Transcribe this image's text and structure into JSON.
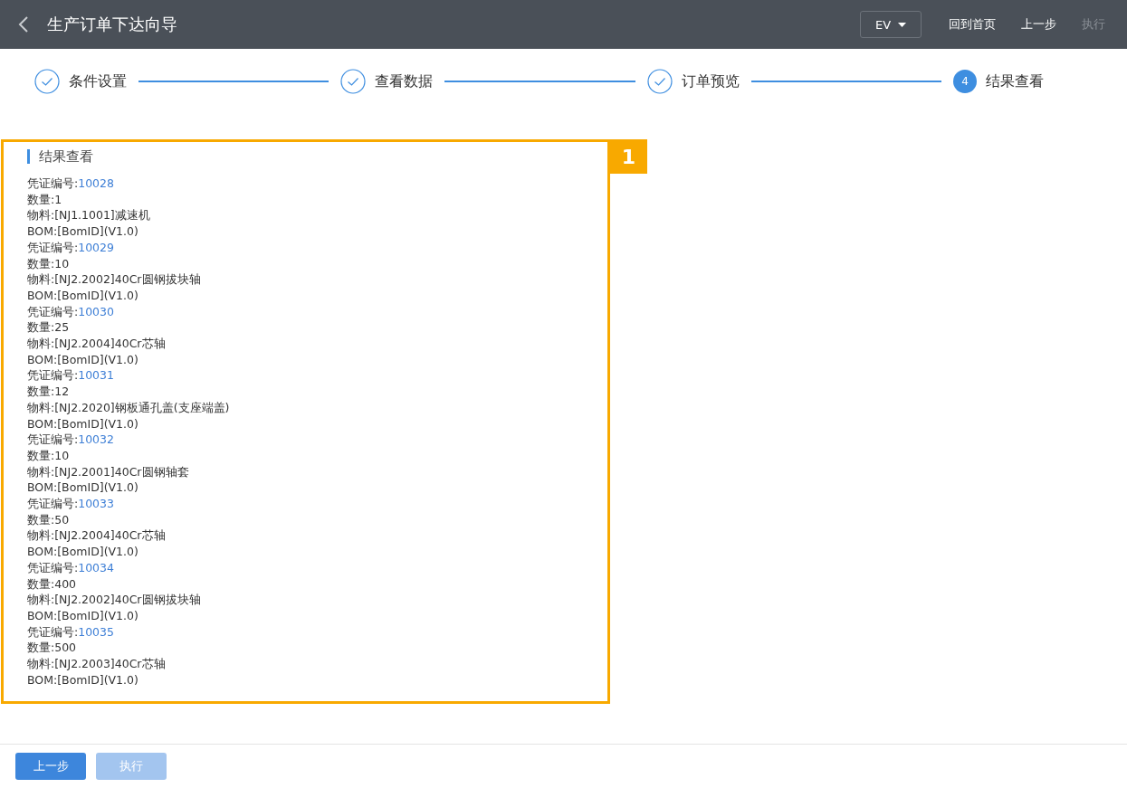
{
  "header": {
    "title": "生产订单下达向导",
    "dropdown": "EV",
    "actions": [
      {
        "label": "回到首页",
        "disabled": false
      },
      {
        "label": "上一步",
        "disabled": false
      },
      {
        "label": "执行",
        "disabled": true
      }
    ]
  },
  "steps": [
    {
      "label": "条件设置",
      "done": true
    },
    {
      "label": "查看数据",
      "done": true
    },
    {
      "label": "订单预览",
      "done": true
    },
    {
      "label": "结果查看",
      "done": false,
      "number": "4"
    }
  ],
  "panel": {
    "title": "结果查看",
    "callout": "1",
    "records": [
      {
        "voucher_label": "凭证编号:",
        "voucher": "10028",
        "quantity": "数量:1",
        "material": "物料:[NJ1.1001]减速机",
        "bom": "BOM:[BomID](V1.0)"
      },
      {
        "voucher_label": "凭证编号:",
        "voucher": "10029",
        "quantity": "数量:10",
        "material": "物料:[NJ2.2002]40Cr圆钢拔块轴",
        "bom": "BOM:[BomID](V1.0)"
      },
      {
        "voucher_label": "凭证编号:",
        "voucher": "10030",
        "quantity": "数量:25",
        "material": "物料:[NJ2.2004]40Cr芯轴",
        "bom": "BOM:[BomID](V1.0)"
      },
      {
        "voucher_label": "凭证编号:",
        "voucher": "10031",
        "quantity": "数量:12",
        "material": "物料:[NJ2.2020]钢板通孔盖(支座端盖)",
        "bom": "BOM:[BomID](V1.0)"
      },
      {
        "voucher_label": "凭证编号:",
        "voucher": "10032",
        "quantity": "数量:10",
        "material": "物料:[NJ2.2001]40Cr圆钢轴套",
        "bom": "BOM:[BomID](V1.0)"
      },
      {
        "voucher_label": "凭证编号:",
        "voucher": "10033",
        "quantity": "数量:50",
        "material": "物料:[NJ2.2004]40Cr芯轴",
        "bom": "BOM:[BomID](V1.0)"
      },
      {
        "voucher_label": "凭证编号:",
        "voucher": "10034",
        "quantity": "数量:400",
        "material": "物料:[NJ2.2002]40Cr圆钢拔块轴",
        "bom": "BOM:[BomID](V1.0)"
      },
      {
        "voucher_label": "凭证编号:",
        "voucher": "10035",
        "quantity": "数量:500",
        "material": "物料:[NJ2.2003]40Cr芯轴",
        "bom": "BOM:[BomID](V1.0)"
      }
    ]
  },
  "footer": {
    "buttons": [
      {
        "label": "上一步",
        "disabled": false
      },
      {
        "label": "执行",
        "disabled": true
      }
    ]
  }
}
